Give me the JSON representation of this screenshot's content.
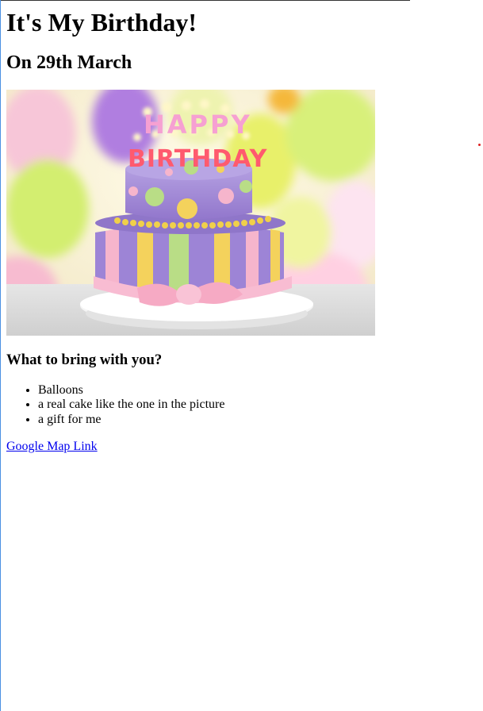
{
  "page": {
    "title": "It's My Birthday!",
    "subtitle": "On 29th March",
    "section_heading": "What to bring with you?",
    "items": [
      "Balloons",
      "a real cake like the one in the picture",
      "a gift for me"
    ],
    "link_text": "Google Map Link"
  },
  "image": {
    "cake_topper_top": "HAPPY",
    "cake_topper_bottom": "BIRTHDAY"
  },
  "colors": {
    "link": "#0000ee",
    "cake_purple": "#a98fd8",
    "frosting_pink": "#f6b5cc",
    "stripe_yellow": "#f4d25c",
    "stripe_green": "#b9dd86"
  }
}
